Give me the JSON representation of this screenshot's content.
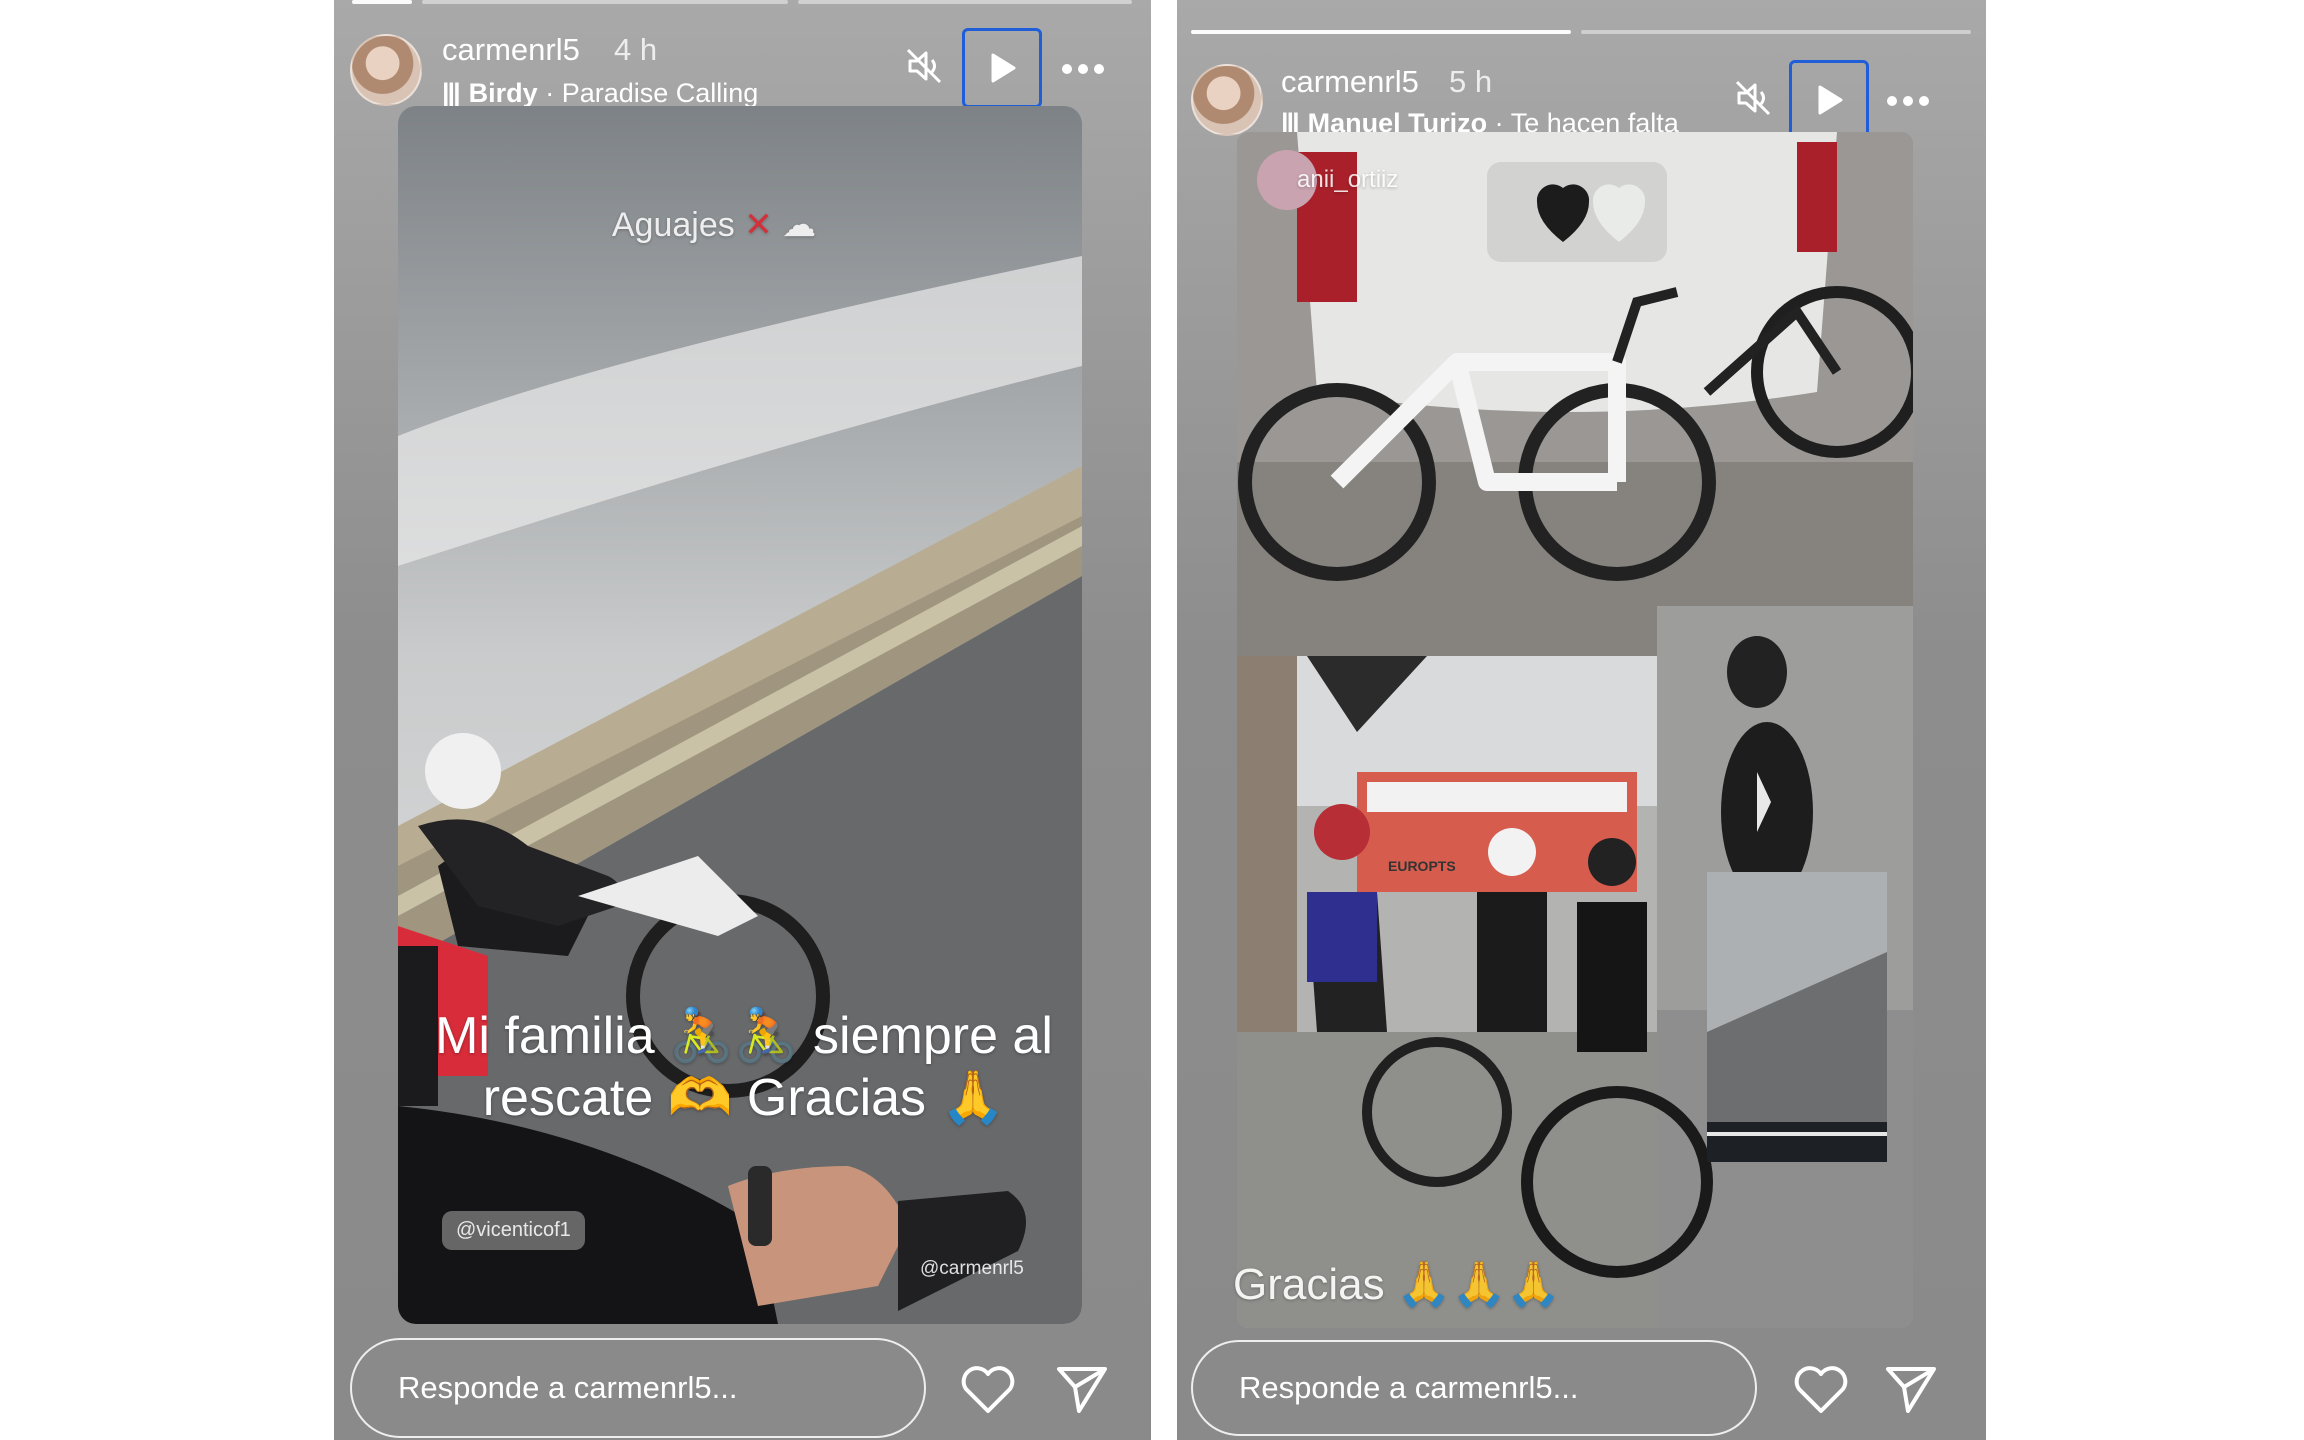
{
  "stories": [
    {
      "username": "carmenrl5",
      "time_ago": "4 h",
      "music": {
        "artist": "Birdy",
        "song": "Paradise Calling"
      },
      "texts": {
        "top": "Aguajes",
        "main_line1": "Mi familia 🚴🚴 siempre al",
        "main_line2": "rescate 🫶 Gracias 🙏",
        "mention_a": "@vicenticof1",
        "mention_b": "@carmenrl5"
      },
      "reply_placeholder": "Responde a carmenrl5..."
    },
    {
      "username": "carmenrl5",
      "time_ago": "5 h",
      "music": {
        "artist": "Manuel Turizo",
        "song": "Te hacen falta"
      },
      "texts": {
        "tag": "anii_ortiiz",
        "gym_sign": "EUROPTS",
        "bottom": "Gracias 🙏🙏🙏"
      },
      "reply_placeholder": "Responde a carmenrl5..."
    }
  ],
  "icons": {
    "mute": "speaker-muted-icon",
    "play": "play-icon",
    "more": "more-dots-icon",
    "like": "heart-icon",
    "share": "paper-plane-icon"
  },
  "colors": {
    "play_focus": "#1f5ed8"
  }
}
